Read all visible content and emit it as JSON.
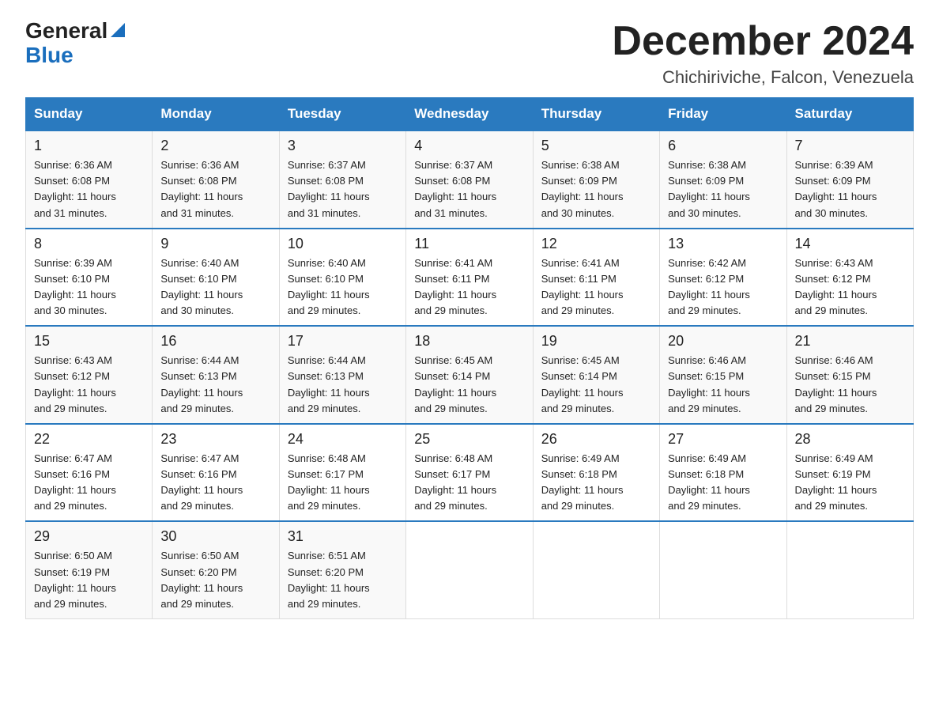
{
  "header": {
    "logo_general": "General",
    "logo_blue": "Blue",
    "title": "December 2024",
    "subtitle": "Chichiriviche, Falcon, Venezuela"
  },
  "columns": [
    "Sunday",
    "Monday",
    "Tuesday",
    "Wednesday",
    "Thursday",
    "Friday",
    "Saturday"
  ],
  "weeks": [
    [
      {
        "day": "1",
        "sunrise": "6:36 AM",
        "sunset": "6:08 PM",
        "daylight": "11 hours and 31 minutes."
      },
      {
        "day": "2",
        "sunrise": "6:36 AM",
        "sunset": "6:08 PM",
        "daylight": "11 hours and 31 minutes."
      },
      {
        "day": "3",
        "sunrise": "6:37 AM",
        "sunset": "6:08 PM",
        "daylight": "11 hours and 31 minutes."
      },
      {
        "day": "4",
        "sunrise": "6:37 AM",
        "sunset": "6:08 PM",
        "daylight": "11 hours and 31 minutes."
      },
      {
        "day": "5",
        "sunrise": "6:38 AM",
        "sunset": "6:09 PM",
        "daylight": "11 hours and 30 minutes."
      },
      {
        "day": "6",
        "sunrise": "6:38 AM",
        "sunset": "6:09 PM",
        "daylight": "11 hours and 30 minutes."
      },
      {
        "day": "7",
        "sunrise": "6:39 AM",
        "sunset": "6:09 PM",
        "daylight": "11 hours and 30 minutes."
      }
    ],
    [
      {
        "day": "8",
        "sunrise": "6:39 AM",
        "sunset": "6:10 PM",
        "daylight": "11 hours and 30 minutes."
      },
      {
        "day": "9",
        "sunrise": "6:40 AM",
        "sunset": "6:10 PM",
        "daylight": "11 hours and 30 minutes."
      },
      {
        "day": "10",
        "sunrise": "6:40 AM",
        "sunset": "6:10 PM",
        "daylight": "11 hours and 29 minutes."
      },
      {
        "day": "11",
        "sunrise": "6:41 AM",
        "sunset": "6:11 PM",
        "daylight": "11 hours and 29 minutes."
      },
      {
        "day": "12",
        "sunrise": "6:41 AM",
        "sunset": "6:11 PM",
        "daylight": "11 hours and 29 minutes."
      },
      {
        "day": "13",
        "sunrise": "6:42 AM",
        "sunset": "6:12 PM",
        "daylight": "11 hours and 29 minutes."
      },
      {
        "day": "14",
        "sunrise": "6:43 AM",
        "sunset": "6:12 PM",
        "daylight": "11 hours and 29 minutes."
      }
    ],
    [
      {
        "day": "15",
        "sunrise": "6:43 AM",
        "sunset": "6:12 PM",
        "daylight": "11 hours and 29 minutes."
      },
      {
        "day": "16",
        "sunrise": "6:44 AM",
        "sunset": "6:13 PM",
        "daylight": "11 hours and 29 minutes."
      },
      {
        "day": "17",
        "sunrise": "6:44 AM",
        "sunset": "6:13 PM",
        "daylight": "11 hours and 29 minutes."
      },
      {
        "day": "18",
        "sunrise": "6:45 AM",
        "sunset": "6:14 PM",
        "daylight": "11 hours and 29 minutes."
      },
      {
        "day": "19",
        "sunrise": "6:45 AM",
        "sunset": "6:14 PM",
        "daylight": "11 hours and 29 minutes."
      },
      {
        "day": "20",
        "sunrise": "6:46 AM",
        "sunset": "6:15 PM",
        "daylight": "11 hours and 29 minutes."
      },
      {
        "day": "21",
        "sunrise": "6:46 AM",
        "sunset": "6:15 PM",
        "daylight": "11 hours and 29 minutes."
      }
    ],
    [
      {
        "day": "22",
        "sunrise": "6:47 AM",
        "sunset": "6:16 PM",
        "daylight": "11 hours and 29 minutes."
      },
      {
        "day": "23",
        "sunrise": "6:47 AM",
        "sunset": "6:16 PM",
        "daylight": "11 hours and 29 minutes."
      },
      {
        "day": "24",
        "sunrise": "6:48 AM",
        "sunset": "6:17 PM",
        "daylight": "11 hours and 29 minutes."
      },
      {
        "day": "25",
        "sunrise": "6:48 AM",
        "sunset": "6:17 PM",
        "daylight": "11 hours and 29 minutes."
      },
      {
        "day": "26",
        "sunrise": "6:49 AM",
        "sunset": "6:18 PM",
        "daylight": "11 hours and 29 minutes."
      },
      {
        "day": "27",
        "sunrise": "6:49 AM",
        "sunset": "6:18 PM",
        "daylight": "11 hours and 29 minutes."
      },
      {
        "day": "28",
        "sunrise": "6:49 AM",
        "sunset": "6:19 PM",
        "daylight": "11 hours and 29 minutes."
      }
    ],
    [
      {
        "day": "29",
        "sunrise": "6:50 AM",
        "sunset": "6:19 PM",
        "daylight": "11 hours and 29 minutes."
      },
      {
        "day": "30",
        "sunrise": "6:50 AM",
        "sunset": "6:20 PM",
        "daylight": "11 hours and 29 minutes."
      },
      {
        "day": "31",
        "sunrise": "6:51 AM",
        "sunset": "6:20 PM",
        "daylight": "11 hours and 29 minutes."
      },
      null,
      null,
      null,
      null
    ]
  ]
}
